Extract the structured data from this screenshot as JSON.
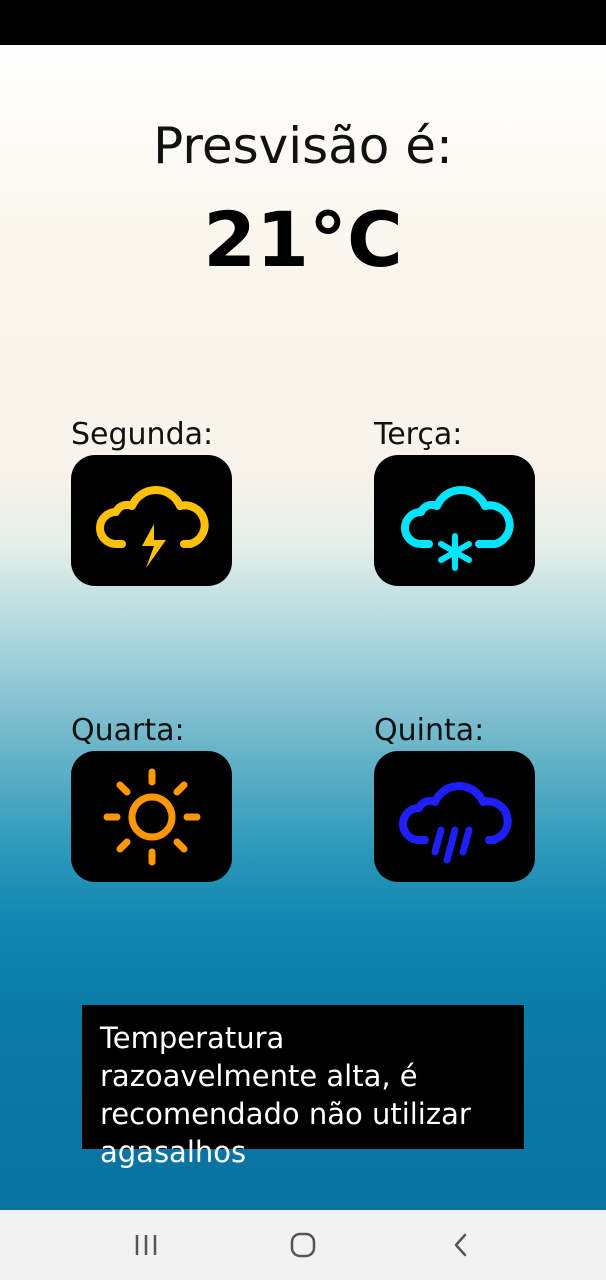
{
  "forecast": {
    "title": "Presvisão é:",
    "temperature": "21°C"
  },
  "days": [
    {
      "label": "Segunda:",
      "icon": "thunderstorm-icon",
      "color": "#FFC107"
    },
    {
      "label": "Terça:",
      "icon": "snow-cloud-icon",
      "color": "#00E5FF"
    },
    {
      "label": "Quarta:",
      "icon": "sun-icon",
      "color": "#FF9800"
    },
    {
      "label": "Quinta:",
      "icon": "rain-cloud-icon",
      "color": "#1E1EFF"
    }
  ],
  "message": "Temperatura razoavelmente alta, é recomendado não utilizar agasalhos",
  "navigation": [
    "recent-apps-icon",
    "home-icon",
    "back-icon"
  ]
}
